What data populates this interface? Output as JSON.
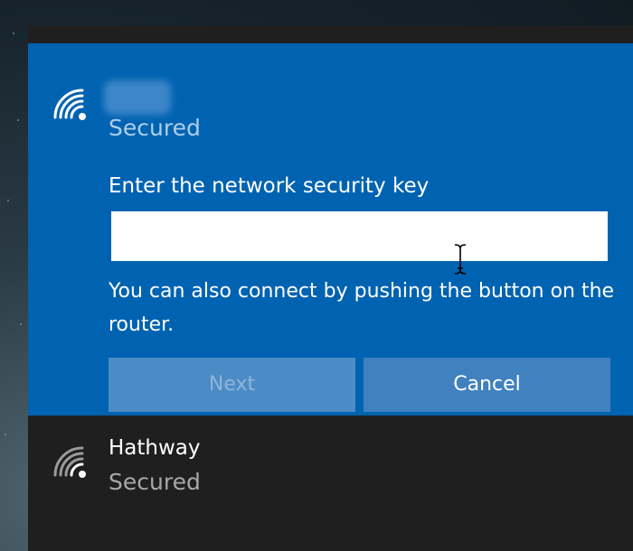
{
  "selected_network": {
    "icon": "wifi-signal-icon",
    "status": "Secured",
    "key_label": "Enter the network security key",
    "key_value": "",
    "wps_hint": "You can also connect by pushing the button on the router.",
    "next_label": "Next",
    "cancel_label": "Cancel"
  },
  "networks": [
    {
      "name": "Hathway",
      "status": "Secured",
      "icon": "wifi-signal-icon"
    }
  ],
  "colors": {
    "accent": "#0063b1",
    "flyout_bg": "#1f1f1f",
    "button_next": "#4c8cc6",
    "button_cancel": "#4081bf",
    "secondary_text_dark": "#a8a8a8",
    "secondary_text_accent": "#aecde8"
  }
}
